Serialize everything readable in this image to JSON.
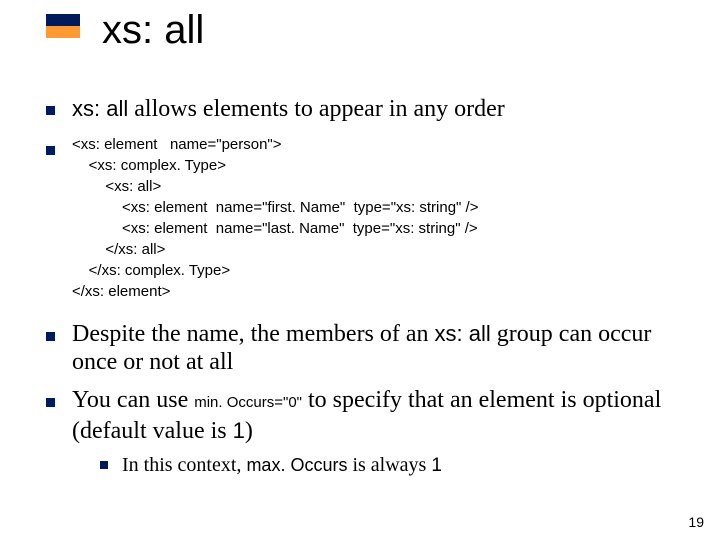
{
  "title": "xs: all",
  "bullets": {
    "b1": {
      "kw": "xs: all",
      "rest": " allows elements to appear in any order"
    },
    "code": "<xs: element   name=\"person\">\n    <xs: complex. Type>\n        <xs: all>\n            <xs: element  name=\"first. Name\"  type=\"xs: string\" />\n            <xs: element  name=\"last. Name\"  type=\"xs: string\" />\n        </xs: all>\n    </xs: complex. Type>\n</xs: element>",
    "b3": {
      "pre": "Despite the name, the members of an ",
      "kw": "xs: all",
      "post": " group can occur once or not at all"
    },
    "b4": {
      "pre": "You can use ",
      "kw": "min. Occurs=\"0\"",
      "mid": " to specify that an element is optional (default value is ",
      "one": "1",
      "post": ")"
    },
    "sub": {
      "pre": "In this context, ",
      "kw": "max. Occurs",
      "mid": " is always ",
      "one": "1"
    }
  },
  "page": "19"
}
